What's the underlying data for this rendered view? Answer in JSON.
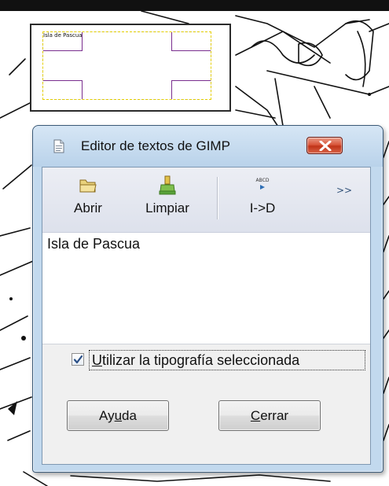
{
  "canvas": {
    "text_layer_content": "Isla de Pascua"
  },
  "dialog": {
    "title": "Editor de textos de GIMP",
    "app_icon": "gimp-text-editor-icon",
    "close_icon": "close-x-icon",
    "close_color": "#d9573c"
  },
  "toolbar": {
    "open_label": "Abrir",
    "open_icon": "folder-icon",
    "clear_label": "Limpiar",
    "clear_icon": "broom-icon",
    "direction_label": "I->D",
    "direction_icon": "text-direction-icon",
    "overflow_label": ">>"
  },
  "editor": {
    "text": "Isla de Pascua"
  },
  "checkbox": {
    "checked": true,
    "label_mnemonic": "U",
    "label_rest": "tilizar la tipografía seleccionada"
  },
  "buttons": {
    "help_before": "Ay",
    "help_mnemonic": "u",
    "help_after": "da",
    "close_mnemonic": "C",
    "close_rest": "errar"
  }
}
